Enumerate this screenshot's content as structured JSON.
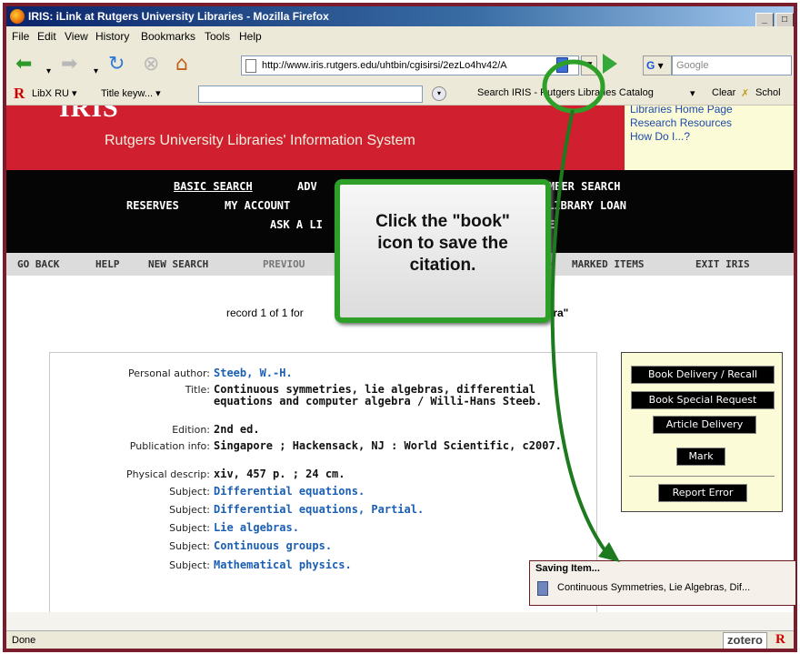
{
  "window": {
    "title": "IRIS: iLink at Rutgers University Libraries - Mozilla Firefox",
    "buttons": [
      "_",
      "□"
    ]
  },
  "menu": [
    "File",
    "Edit",
    "View",
    "History",
    "Bookmarks",
    "Tools",
    "Help"
  ],
  "nav": {
    "url": "http://www.iris.rutgers.edu/uhtbin/cgisirsi/2ezLo4hv42/A",
    "search_placeholder": "Google",
    "g_label": "G"
  },
  "libx": {
    "logo": "R",
    "libx_label": "LibX RU",
    "title_label": "Title keyw...",
    "search_label": "Search IRIS - Rutgers Libraries Catalog",
    "clear_label": "Clear",
    "scholar_label": "Schol"
  },
  "banner": {
    "big": "IRIS",
    "subtitle": "Rutgers University Libraries' Information System",
    "links": [
      "Libraries Home Page",
      "Research Resources",
      "How Do I...?"
    ]
  },
  "blackbar": {
    "basic_search": "BASIC SEARCH",
    "adv": "ADV",
    "number_search": "MBER SEARCH",
    "reserves": "RESERVES",
    "my_account": "MY ACCOUNT",
    "ill": "RLIBRARY LOAN",
    "ask": "ASK A LI",
    "ask_end": "E"
  },
  "graybar": {
    "go_back": "GO BACK",
    "help": "HELP",
    "new_search": "NEW SEARCH",
    "previous": "PREVIOU",
    "slash": "/",
    "marked": "MARKED ITEMS",
    "exit": "EXIT IRIS"
  },
  "record_line": {
    "prefix": "record 1 of 1 for",
    "suffix": "gebra\""
  },
  "record": {
    "author_label": "Personal author:",
    "author": "Steeb, W.-H.",
    "title_label": "Title:",
    "title": "Continuous symmetries, lie algebras, differential equations and computer algebra / Willi-Hans Steeb.",
    "edition_label": "Edition:",
    "edition": "2nd ed.",
    "pub_label": "Publication info:",
    "pub": "Singapore ; Hackensack, NJ : World Scientific, c2007.",
    "phys_label": "Physical descrip:",
    "phys": "xiv, 457 p. ; 24 cm.",
    "subject_label": "Subject:",
    "subjects": [
      "Differential equations.",
      "Differential equations, Partial.",
      "Lie algebras.",
      "Continuous groups.",
      "Mathematical physics."
    ]
  },
  "side_buttons": [
    "Book Delivery / Recall",
    "Book Special Request",
    "Article Delivery",
    "Mark",
    "Report Error"
  ],
  "callout": {
    "lines": [
      "Click the \"book\"",
      "icon to save the",
      "citation."
    ]
  },
  "zotero": {
    "heading": "Saving Item...",
    "item": "Continuous Symmetries, Lie Algebras, Dif..."
  },
  "status": {
    "text": "Done",
    "zotero": "zotero",
    "r": "R"
  },
  "colors": {
    "annotation_green": "#2ea02a",
    "banner_red": "#d01f2e",
    "link_blue": "#1a5fb4",
    "frame_maroon": "#7a1c2c"
  }
}
